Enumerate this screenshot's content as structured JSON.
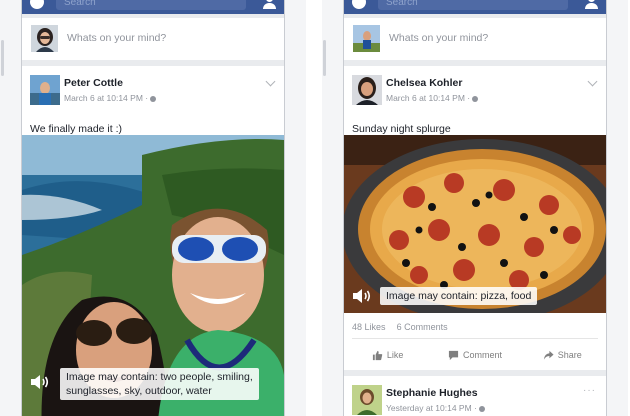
{
  "navbar": {
    "search_placeholder": "Search",
    "color": "#3b5998",
    "left_icon": "messenger-icon",
    "right_icon": "friends-icon"
  },
  "composer": {
    "prompt": "Whats on your mind?"
  },
  "left_post": {
    "author": "Peter Cottle",
    "timestamp": "March 6 at 10:14 PM ·",
    "text": "We finally made it :)",
    "alt_text_line1": "Image may contain: two people, smiling,",
    "alt_text_line2": "sunglasses, sky, outdoor, water",
    "privacy_icon": "globe-icon"
  },
  "right_post": {
    "author": "Chelsea Kohler",
    "timestamp": "March 6 at 10:14 PM ·",
    "text": "Sunday night splurge",
    "alt_text": "Image may contain: pizza, food",
    "likes": "48 Likes",
    "comments": "6 Comments",
    "actions": {
      "like": "Like",
      "comment": "Comment",
      "share": "Share"
    }
  },
  "next_post": {
    "author": "Stephanie Hughes",
    "timestamp": "Yesterday at 10:14 PM ·"
  }
}
